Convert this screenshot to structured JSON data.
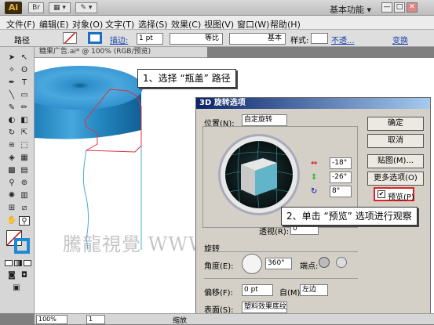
{
  "app": {
    "logo": "Ai",
    "workspace": "基本功能 ▾",
    "window_buttons": [
      "—",
      "□",
      "✕"
    ],
    "bridge_buttons": [
      "Br",
      "▦ ▾",
      "✎ ▾"
    ]
  },
  "menu": {
    "items": [
      "文件(F)",
      "编辑(E)",
      "对象(O)",
      "文字(T)",
      "选择(S)",
      "效果(C)",
      "视图(V)",
      "窗口(W)",
      "帮助(H)"
    ]
  },
  "control_bar": {
    "object_label": "路径",
    "stroke_link": "描边:",
    "stroke_value": "1 pt",
    "profile_label": "等比",
    "brush_label": "基本",
    "style_label": "样式:",
    "opacity_link": "不透...",
    "transform_link": "变换"
  },
  "document": {
    "tab_title": "糖果广告.ai* @ 100% (RGB/预览)",
    "zoom": "100%",
    "page": "1",
    "status_label": "缩放"
  },
  "callouts": {
    "step1": "1、选择 “瓶盖” 路径",
    "step2": "2、单击 “预览” 选项进行观察"
  },
  "watermark": "騰龍視覺 WWW.TLVI.NET",
  "dialog": {
    "title": "3D 旋转选项",
    "position_label": "位置(N):",
    "position_value": "自定旋转",
    "rotate_x": "-18°",
    "rotate_y": "-26°",
    "rotate_z": "8°",
    "perspective_label": "透视(R):",
    "perspective_value": "0°",
    "extrude_section": "旋转",
    "angle_label": "角度(E):",
    "angle_value": "360°",
    "cap_label": "端点:",
    "offset_label": "偏移(F):",
    "offset_value": "0 pt",
    "offset_from": "自(M)",
    "offset_side": "左边",
    "surface_label": "表面(S):",
    "surface_value": "塑料效果底纹",
    "buttons": {
      "ok": "确定",
      "cancel": "取消",
      "map": "贴图(M)...",
      "more": "更多选项(O)",
      "preview": "预览(P)"
    },
    "preview_checked": true
  }
}
